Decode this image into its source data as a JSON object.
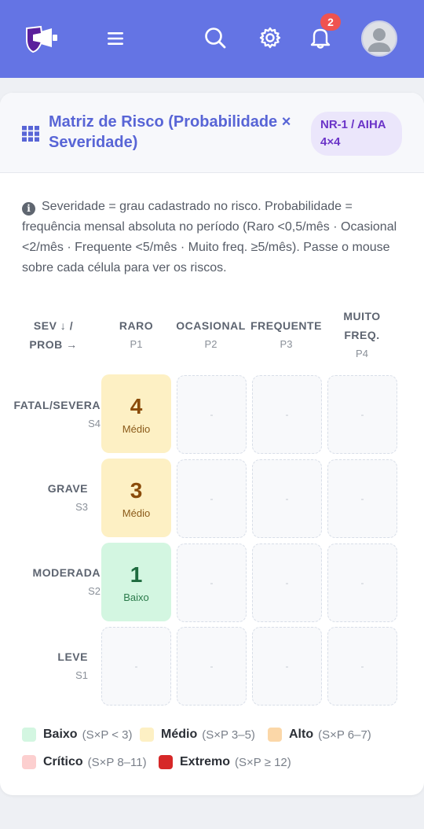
{
  "header": {
    "notification_count": "2",
    "icons": [
      "megaphone-logo-icon",
      "menu-icon",
      "search-icon",
      "gear-icon",
      "bell-icon",
      "user-avatar-icon"
    ],
    "color": "#6474e4"
  },
  "card": {
    "title": "Matriz de Risco (Probabilidade × Severidade)",
    "tag": "NR-1 / AIHA 4×4",
    "info": "Severidade = grau cadastrado no risco. Probabilidade = frequência mensal absoluta no período (Raro <0,5/mês · Ocasional <2/mês · Frequente <5/mês · Muito freq. ≥5/mês). Passe o mouse sobre cada célula para ver os riscos."
  },
  "matrix": {
    "corner": "SEV ↓ / PROB →",
    "columns": [
      {
        "label": "RARO",
        "code": "P1"
      },
      {
        "label": "OCASIONAL",
        "code": "P2"
      },
      {
        "label": "FREQUENTE",
        "code": "P3"
      },
      {
        "label": "MUITO FREQ.",
        "code": "P4"
      }
    ],
    "rows": [
      {
        "label": "FATAL/SEVERA",
        "code": "S4",
        "cells": [
          {
            "value": "4",
            "level": "Médio"
          },
          {
            "value": "-"
          },
          {
            "value": "-"
          },
          {
            "value": "-"
          }
        ]
      },
      {
        "label": "GRAVE",
        "code": "S3",
        "cells": [
          {
            "value": "3",
            "level": "Médio"
          },
          {
            "value": "-"
          },
          {
            "value": "-"
          },
          {
            "value": "-"
          }
        ]
      },
      {
        "label": "MODERADA",
        "code": "S2",
        "cells": [
          {
            "value": "1",
            "level": "Baixo"
          },
          {
            "value": "-"
          },
          {
            "value": "-"
          },
          {
            "value": "-"
          }
        ]
      },
      {
        "label": "LEVE",
        "code": "S1",
        "cells": [
          {
            "value": "-"
          },
          {
            "value": "-"
          },
          {
            "value": "-"
          },
          {
            "value": "-"
          }
        ]
      }
    ]
  },
  "legend": [
    {
      "name": "Baixo",
      "range": "(S×P < 3)",
      "color": "#d3f6e1"
    },
    {
      "name": "Médio",
      "range": "(S×P 3–5)",
      "color": "#fdf0c4"
    },
    {
      "name": "Alto",
      "range": "(S×P 6–7)",
      "color": "#fbd7a8"
    },
    {
      "name": "Crítico",
      "range": "(S×P 8–11)",
      "color": "#fccfcf"
    },
    {
      "name": "Extremo",
      "range": "(S×P ≥ 12)",
      "color": "#d62828"
    }
  ]
}
